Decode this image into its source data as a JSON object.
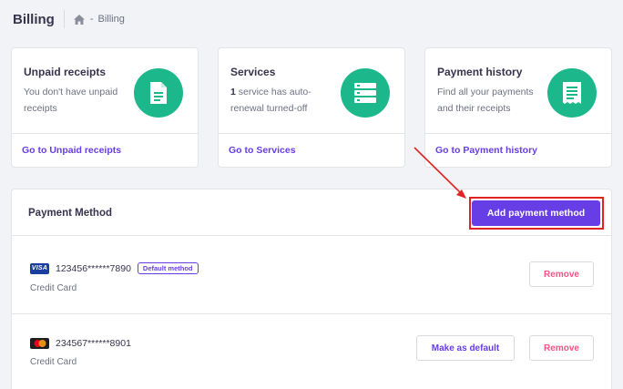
{
  "header": {
    "title": "Billing",
    "breadcrumb_current": "Billing",
    "breadcrumb_separator": "-"
  },
  "cards": [
    {
      "title": "Unpaid receipts",
      "desc": "You don't have unpaid receipts",
      "link": "Go to Unpaid receipts",
      "icon": "receipt-icon"
    },
    {
      "title": "Services",
      "count": "1",
      "desc_rest": " service has auto-renewal turned-off",
      "link": "Go to Services",
      "icon": "server-icon"
    },
    {
      "title": "Payment history",
      "desc": "Find all your payments and their receipts",
      "link": "Go to Payment history",
      "icon": "invoice-icon"
    }
  ],
  "payment": {
    "title": "Payment Method",
    "add_label": "Add payment method",
    "methods": [
      {
        "brand_text": "VISA",
        "number": "123456******7890",
        "default_tag": "Default method",
        "type": "Credit Card",
        "remove_label": "Remove"
      },
      {
        "number": "234567******8901",
        "type": "Credit Card",
        "make_default_label": "Make as default",
        "remove_label": "Remove"
      }
    ]
  },
  "colors": {
    "accent": "#673de6",
    "badge_green": "#1cb88c",
    "danger": "#fc5185",
    "highlight_red": "#e02424"
  }
}
